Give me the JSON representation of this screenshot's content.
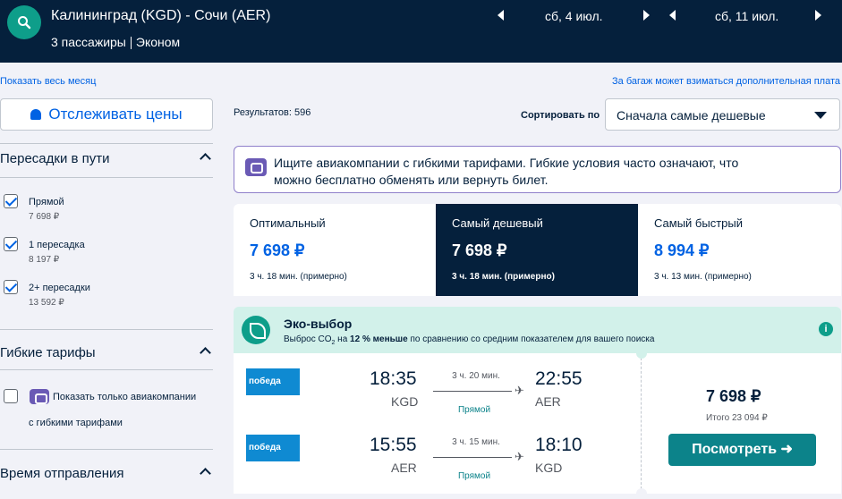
{
  "header": {
    "route": "Калининград (KGD) - Сочи (AER)",
    "passengers": "3 пассажиры",
    "cabin": "Эконом",
    "depart_date": "сб, 4 июл.",
    "return_date": "сб, 11 июл."
  },
  "links": {
    "show_month": "Показать весь месяц",
    "baggage_note": "За багаж может взиматься дополнительная плата"
  },
  "sidebar": {
    "track_prices": "Отслеживать цены",
    "stops": {
      "title": "Пересадки в пути",
      "options": [
        {
          "label": "Прямой",
          "price": "7 698 ₽",
          "checked": true
        },
        {
          "label": "1 пересадка",
          "price": "8 197 ₽",
          "checked": true
        },
        {
          "label": "2+ пересадки",
          "price": "13 592 ₽",
          "checked": true
        }
      ]
    },
    "flexible": {
      "title": "Гибкие тарифы",
      "option_line1": "Показать только авиакомпании",
      "option_line2": "с гибкими тарифами",
      "checked": false
    },
    "departure": {
      "title": "Время отправления"
    }
  },
  "results": {
    "count_label": "Результатов: 596",
    "sort_label": "Сортировать по",
    "sort_value": "Сначала самые дешевые"
  },
  "notice": {
    "line1": "Ищите авиакомпании с гибкими тарифами. Гибкие условия часто означают, что",
    "line2": "можно бесплатно обменять или вернуть билет."
  },
  "tabs": [
    {
      "name": "Оптимальный",
      "price": "7 698 ₽",
      "duration": "3 ч. 18 мин. (примерно)",
      "active": false
    },
    {
      "name": "Самый дешевый",
      "price": "7 698 ₽",
      "duration": "3 ч. 18 мин. (примерно)",
      "active": true
    },
    {
      "name": "Самый быстрый",
      "price": "8 994 ₽",
      "duration": "3 ч. 13 мин. (примерно)",
      "active": false
    }
  ],
  "eco": {
    "title": "Эко-выбор",
    "text_pre": "Выброс CO",
    "text_sub": "2",
    "text_mid": " на ",
    "text_bold": "12 % меньше",
    "text_post": " по сравнению со средним показателем для вашего поиска",
    "info": "i"
  },
  "flight": {
    "airline": "победа",
    "outbound": {
      "dep_time": "18:35",
      "dep_code": "KGD",
      "duration": "3 ч. 20 мин.",
      "stops": "Прямой",
      "arr_time": "22:55",
      "arr_code": "AER"
    },
    "inbound": {
      "dep_time": "15:55",
      "dep_code": "AER",
      "duration": "3 ч. 15 мин.",
      "stops": "Прямой",
      "arr_time": "18:10",
      "arr_code": "KGD"
    },
    "price": "7 698 ₽",
    "total": "Итого 23 094 ₽",
    "view_button": "Посмотреть ➜"
  },
  "colors": {
    "navy": "#05203c",
    "accent": "#0062e3",
    "teal": "#0c838a",
    "eco_bg": "#d2f1ea"
  }
}
